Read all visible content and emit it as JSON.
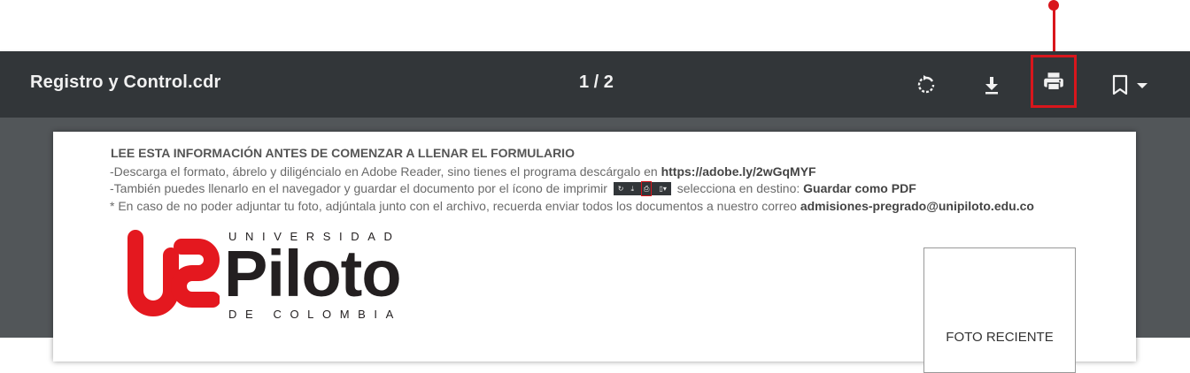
{
  "annotation": {
    "color": "#d9161c"
  },
  "toolbar": {
    "title": "Registro y Control.cdr",
    "page_indicator": "1 / 2",
    "buttons": {
      "rotate": {
        "icon": "rotate-icon"
      },
      "download": {
        "icon": "download-icon"
      },
      "print": {
        "icon": "print-icon"
      },
      "bookmark": {
        "icon": "bookmark-icon",
        "dropdown_icon": "caret-down-icon"
      }
    }
  },
  "document": {
    "notice_heading": "LEE ESTA INFORMACIÓN ANTES DE COMENZAR A LLENAR EL FORMULARIO",
    "line1_text": "-Descarga el formato, ábrelo y diligéncialo en Adobe Reader, sino tienes el programa descárgalo en ",
    "line1_link": "https://adobe.ly/2wGqMYF",
    "line2_text": "-También puedes llenarlo en el navegador y guardar el documento por el ícono de imprimir",
    "line2_after": " selecciona en destino: ",
    "line2_bold": "Guardar como PDF",
    "line3_text": "* En caso de no poder adjuntar tu foto, adjúntala junto con el archivo, recuerda enviar todos los documentos a nuestro correo ",
    "line3_email": "admisiones-pregrado@unipiloto.edu.co",
    "logo": {
      "top_text": "UNIVERSIDAD",
      "main_text": "Piloto",
      "bottom_text": "DE COLOMBIA",
      "mark_color": "#e4181f"
    },
    "photo_box_label": "FOTO RECIENTE"
  }
}
